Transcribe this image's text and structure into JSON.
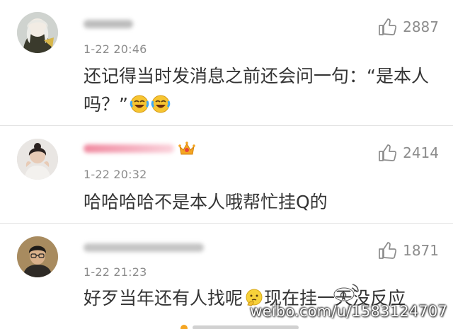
{
  "comments": [
    {
      "username": "",
      "time": "1-22 20:46",
      "text_before_emoji": "还记得当时发消息之前还会问一句：“是本人吗？”",
      "likes": "2887",
      "emoji": "laughing-tears-emoji"
    },
    {
      "username": "",
      "time": "1-22 20:32",
      "text": "哈哈哈哈不是本人哦帮忙挂Q的",
      "likes": "2414",
      "badge": "crown-badge-icon"
    },
    {
      "username": "",
      "time": "1-22 21:23",
      "text_before_emoji": "好歹当年还有人找呢",
      "text_after_emoji": "现在挂一天没反应",
      "likes": "1871",
      "emoji": "thinking-face-emoji"
    }
  ],
  "watermark": "weibo.com/u/1583124707",
  "colors": {
    "text": "#333333",
    "meta": "#8c8c8c",
    "divider": "#e3e3e3"
  },
  "icons": {
    "like": "thumbs-up-icon"
  }
}
